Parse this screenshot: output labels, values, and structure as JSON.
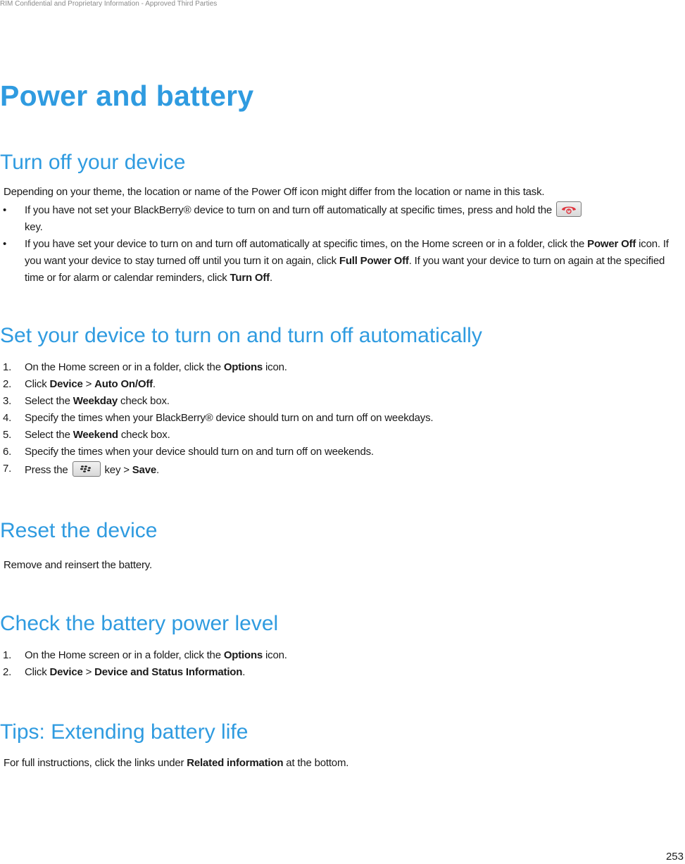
{
  "header": {
    "confidential_notice": "RIM Confidential and Proprietary Information - Approved Third Parties"
  },
  "page_title": "Power and battery",
  "sections": {
    "turn_off": {
      "heading": "Turn off your device",
      "intro": "Depending on your theme, the location or name of the Power Off icon might differ from the location or name in this task.",
      "bullets": [
        {
          "marker": "•",
          "text_before": "If you have not set your BlackBerry® device to turn on and turn off automatically at specific times, press and hold the",
          "icon": "end-call-power-key-icon",
          "text_after": "key."
        },
        {
          "marker": "•",
          "t1": "If you have set your device to turn on and turn off automatically at specific times, on the Home screen or in a folder, click the ",
          "b1": "Power Off",
          "t2": " icon. If you want your device to stay turned off until you turn it on again, click ",
          "b2": "Full Power Off",
          "t3": ". If you want your device to turn on again at the specified time or for alarm or calendar reminders, click ",
          "b3": "Turn Off",
          "t4": "."
        }
      ]
    },
    "auto_on_off": {
      "heading": "Set your device to turn on and turn off automatically",
      "steps": [
        {
          "num": "1.",
          "t1": "On the Home screen or in a folder, click the ",
          "b1": "Options",
          "t2": " icon."
        },
        {
          "num": "2.",
          "t1": "Click ",
          "b1": "Device",
          "t2": " > ",
          "b2": "Auto On/Off",
          "t3": "."
        },
        {
          "num": "3.",
          "t1": "Select the ",
          "b1": "Weekday",
          "t2": " check box."
        },
        {
          "num": "4.",
          "t1": "Specify the times when your BlackBerry® device should turn on and turn off on weekdays."
        },
        {
          "num": "5.",
          "t1": "Select the ",
          "b1": "Weekend",
          "t2": " check box."
        },
        {
          "num": "6.",
          "t1": "Specify the times when your device should turn on and turn off on weekends."
        },
        {
          "num": "7.",
          "t1": "Press the ",
          "icon": "blackberry-menu-key-icon",
          "t2": " key > ",
          "b1": "Save",
          "t3": "."
        }
      ]
    },
    "reset": {
      "heading": "Reset the device",
      "text": "Remove and reinsert the battery."
    },
    "battery_level": {
      "heading": "Check the battery power level",
      "steps": [
        {
          "num": "1.",
          "t1": "On the Home screen or in a folder, click the ",
          "b1": "Options",
          "t2": " icon."
        },
        {
          "num": "2.",
          "t1": "Click ",
          "b1": "Device",
          "t2": " > ",
          "b2": "Device and Status Information",
          "t3": "."
        }
      ]
    },
    "tips": {
      "heading": "Tips: Extending battery life",
      "t1": "For full instructions, click the links under ",
      "b1": "Related information",
      "t2": " at the bottom."
    }
  },
  "footer": {
    "page_number": "253"
  },
  "colors": {
    "heading_blue": "#2f9be0",
    "end_key_red": "#e0333d"
  }
}
